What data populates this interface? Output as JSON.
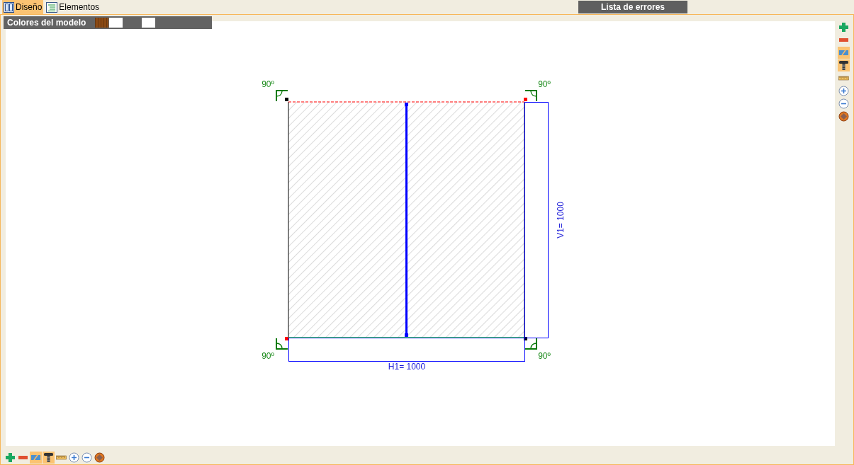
{
  "tabs": [
    {
      "label": "Diseño",
      "selected": true
    },
    {
      "label": "Elementos",
      "selected": false
    }
  ],
  "error_list_button": "Lista de errores",
  "model_colors": {
    "label": "Colores del modelo",
    "swatches": [
      {
        "kind": "texture",
        "color": "#8b4a14"
      },
      {
        "kind": "solid",
        "color": "#ffffff"
      },
      {
        "kind": "solid",
        "color": "#ffffff"
      }
    ]
  },
  "drawing": {
    "angles": [
      "90º",
      "90º",
      "90º",
      "90º"
    ],
    "horizontal_dimension": "H1= 1000",
    "vertical_dimension": "V1= 1000"
  },
  "right_toolbar": [
    {
      "kind": "add",
      "selected": false
    },
    {
      "kind": "remove",
      "selected": false
    },
    {
      "kind": "line",
      "selected": true
    },
    {
      "kind": "screw",
      "selected": true
    },
    {
      "kind": "ruler",
      "selected": false
    },
    {
      "kind": "zoom-in",
      "selected": false
    },
    {
      "kind": "zoom-out",
      "selected": false
    },
    {
      "kind": "target",
      "selected": false
    }
  ],
  "bottom_toolbar": [
    {
      "kind": "add",
      "selected": false
    },
    {
      "kind": "remove",
      "selected": false
    },
    {
      "kind": "line",
      "selected": true
    },
    {
      "kind": "screw",
      "selected": true
    },
    {
      "kind": "ruler",
      "selected": false
    },
    {
      "kind": "zoom-in",
      "selected": false
    },
    {
      "kind": "zoom-out",
      "selected": false
    },
    {
      "kind": "target",
      "selected": false
    }
  ]
}
